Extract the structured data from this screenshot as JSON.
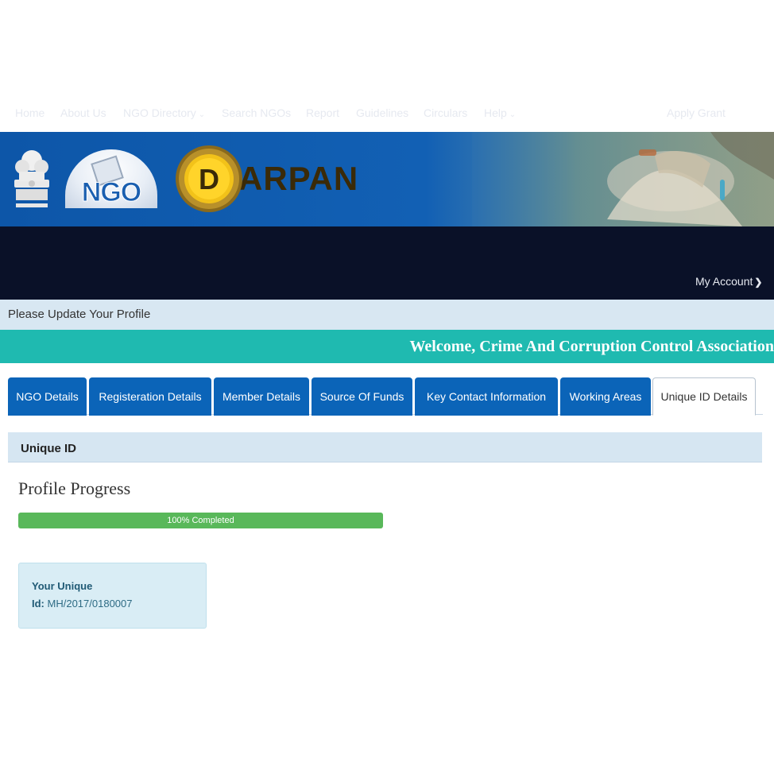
{
  "header": {
    "ngo_logo_text": "NGO",
    "darpan_letter": "D",
    "darpan_word": "ARPAN"
  },
  "nav": {
    "items": [
      {
        "label": "Home",
        "dropdown": false
      },
      {
        "label": "About Us",
        "dropdown": false
      },
      {
        "label": "NGO Directory",
        "dropdown": true
      },
      {
        "label": "Search NGOs",
        "dropdown": false
      },
      {
        "label": "Report",
        "dropdown": false
      },
      {
        "label": "Guidelines",
        "dropdown": false
      },
      {
        "label": "Circulars",
        "dropdown": false
      },
      {
        "label": "Help",
        "dropdown": true
      }
    ],
    "apply_grant": "Apply Grant",
    "my_account": "My Account"
  },
  "notice": "Please Update Your Profile",
  "welcome": "Welcome, Crime And Corruption Control Association",
  "tabs": [
    {
      "label": "NGO Details",
      "active": false
    },
    {
      "label": "Registeration Details",
      "active": false
    },
    {
      "label": "Member Details",
      "active": false
    },
    {
      "label": "Source Of Funds",
      "active": false
    },
    {
      "label": "Key Contact Information",
      "active": false
    },
    {
      "label": "Working Areas",
      "active": false
    },
    {
      "label": "Unique ID Details",
      "active": true
    }
  ],
  "section": {
    "heading": "Unique ID",
    "progress_title": "Profile Progress",
    "progress_percent": 100,
    "progress_label": "100% Completed",
    "unique_id_label_line1": "Your Unique",
    "unique_id_label_line2": "Id:",
    "unique_id_value": "MH/2017/0180007"
  },
  "colors": {
    "banner_blue": "#0d56a8",
    "nav_bg": "#0a1128",
    "welcome_bg": "#1fbab0",
    "tab_blue": "#0b64b8",
    "progress_green": "#59b85a"
  }
}
